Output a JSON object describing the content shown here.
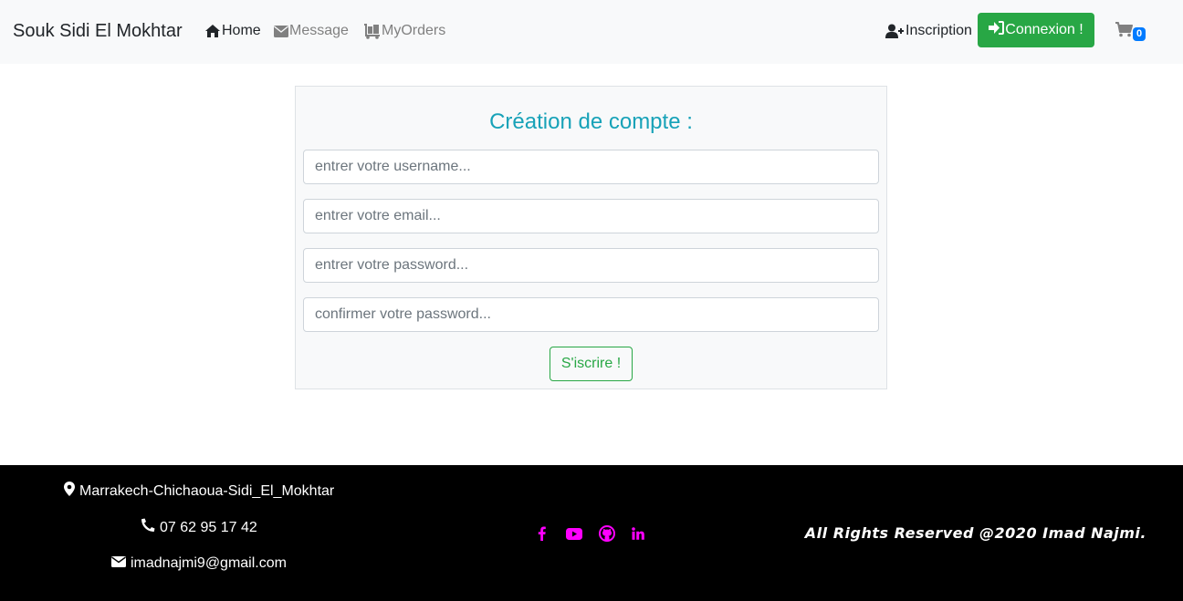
{
  "navbar": {
    "brand": "Souk Sidi El Mokhtar",
    "links": [
      {
        "label": "Home",
        "icon": "home-icon"
      },
      {
        "label": "Message",
        "icon": "envelope-icon"
      },
      {
        "label": "MyOrders",
        "icon": "dolly-icon"
      }
    ],
    "inscription": "Inscription",
    "connexion": "Connexion !",
    "cart_count": "0"
  },
  "form": {
    "title": "Création de compte :",
    "username_placeholder": "entrer votre username...",
    "email_placeholder": "entrer votre email...",
    "password_placeholder": "entrer votre password...",
    "confirm_placeholder": "confirmer votre password...",
    "submit": "S'iscrire !"
  },
  "footer": {
    "address": "Marrakech-Chichaoua-Sidi_El_Mokhtar",
    "phone": "07 62 95 17 42",
    "email": "imadnajmi9@gmail.com",
    "socials": [
      "facebook-icon",
      "youtube-icon",
      "github-icon",
      "linkedin-icon"
    ],
    "rights": "All Rights Reserved @2020 Imad Najmi."
  },
  "colors": {
    "success": "#28a745",
    "info": "#17a2b8",
    "primary": "#007bff",
    "social": "#ff00ff"
  }
}
